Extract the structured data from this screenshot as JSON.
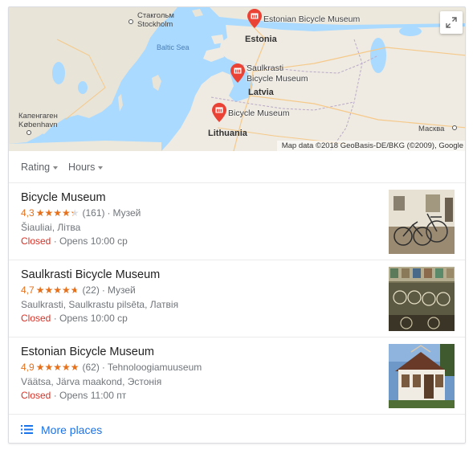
{
  "map": {
    "labels": {
      "stockholm_ru": "Стакгольм",
      "stockholm": "Stockholm",
      "baltic_sea": "Baltic Sea",
      "estonia": "Estonia",
      "latvia": "Latvia",
      "lithuania": "Lithuania",
      "copenhagen_ru": "Капенгаген",
      "copenhagen": "København",
      "moscow": "Масква"
    },
    "pins": {
      "estonian": "Estonian Bicycle Museum",
      "saulkrasti_line1": "Saulkrasti",
      "saulkrasti_line2": "Bicycle Museum",
      "bicycle": "Bicycle Museum"
    },
    "attribution": "Map data ©2018 GeoBasis-DE/BKG (©2009), Google",
    "expand_icon": "fullscreen-expand-icon",
    "pin_color": "#ea4335"
  },
  "filters": {
    "rating": "Rating",
    "hours": "Hours"
  },
  "places": [
    {
      "name": "Bicycle Museum",
      "score": "4,3",
      "stars": 4.3,
      "reviews": "(161)",
      "category": "Музей",
      "address": "Šiauliai, Літва",
      "status": "Closed",
      "opens": "Opens 10:00 ср"
    },
    {
      "name": "Saulkrasti Bicycle Museum",
      "score": "4,7",
      "stars": 4.7,
      "reviews": "(22)",
      "category": "Музей",
      "address": "Saulkrasti, Saulkrastu pilsēta, Латвія",
      "status": "Closed",
      "opens": "Opens 10:00 ср"
    },
    {
      "name": "Estonian Bicycle Museum",
      "score": "4,9",
      "stars": 4.9,
      "reviews": "(62)",
      "category": "Tehnoloogiamuuseum",
      "address": "Väätsa, Järva maakond, Эстонія",
      "status": "Closed",
      "opens": "Opens 11:00 пт"
    }
  ],
  "more": {
    "label": "More places",
    "icon": "list-icon"
  },
  "colors": {
    "star": "#e7711b",
    "closed": "#d93025",
    "link": "#1a73e8"
  }
}
